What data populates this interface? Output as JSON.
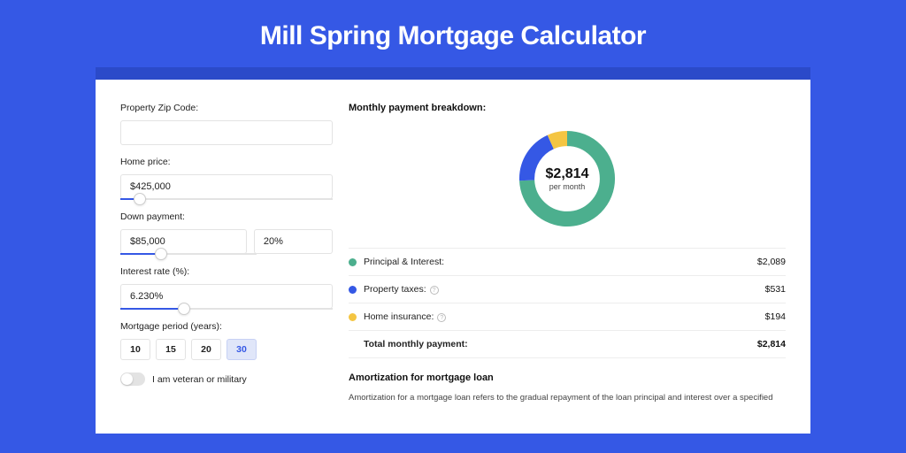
{
  "hero": {
    "title": "Mill Spring Mortgage Calculator"
  },
  "form": {
    "zip_label": "Property Zip Code:",
    "zip_value": "",
    "home_price_label": "Home price:",
    "home_price_value": "$425,000",
    "down_payment_label": "Down payment:",
    "down_payment_value": "$85,000",
    "down_payment_pct": "20%",
    "interest_label": "Interest rate (%):",
    "interest_value": "6.230%",
    "period_label": "Mortgage period (years):",
    "periods": [
      "10",
      "15",
      "20",
      "30"
    ],
    "period_active": "30",
    "veteran_label": "I am veteran or military"
  },
  "breakdown": {
    "title": "Monthly payment breakdown:",
    "donut_amount": "$2,814",
    "donut_sub": "per month",
    "items": [
      {
        "label": "Principal & Interest:",
        "value": "$2,089",
        "color": "green",
        "info": false
      },
      {
        "label": "Property taxes:",
        "value": "$531",
        "color": "blue",
        "info": true
      },
      {
        "label": "Home insurance:",
        "value": "$194",
        "color": "yellow",
        "info": true
      }
    ],
    "total_label": "Total monthly payment:",
    "total_value": "$2,814"
  },
  "amort": {
    "title": "Amortization for mortgage loan",
    "text": "Amortization for a mortgage loan refers to the gradual repayment of the loan principal and interest over a specified"
  },
  "colors": {
    "accent": "#3558E5",
    "green": "#4CAF8E",
    "blue": "#3558E5",
    "yellow": "#F4C542"
  },
  "chart_data": {
    "type": "pie",
    "title": "Monthly payment breakdown",
    "series": [
      {
        "name": "Principal & Interest",
        "value": 2089
      },
      {
        "name": "Property taxes",
        "value": 531
      },
      {
        "name": "Home insurance",
        "value": 194
      }
    ],
    "total": 2814
  }
}
